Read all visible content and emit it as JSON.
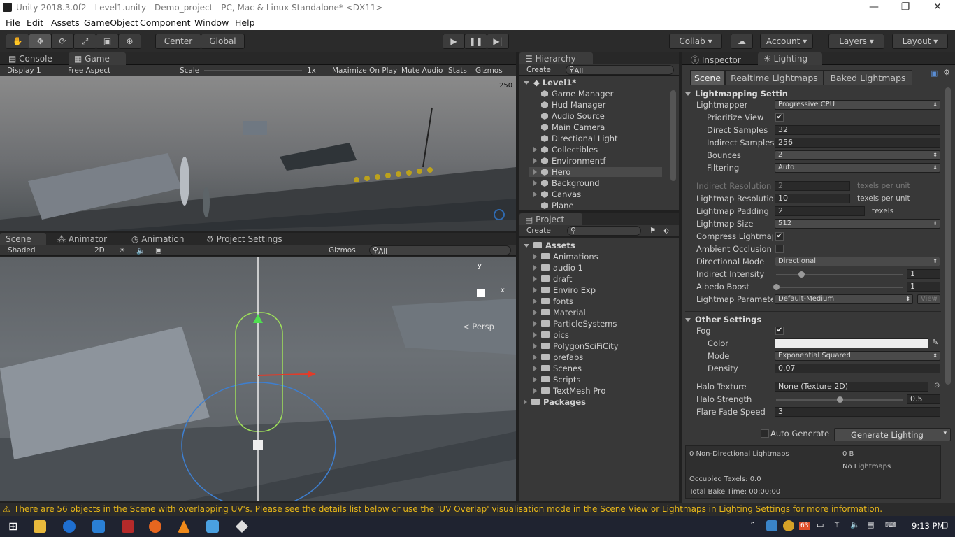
{
  "window": {
    "title": "Unity 2018.3.0f2 - Level1.unity - Demo_project - PC, Mac & Linux Standalone* <DX11>"
  },
  "menu": [
    "File",
    "Edit",
    "Assets",
    "GameObject",
    "Component",
    "Window",
    "Help"
  ],
  "toolbar": {
    "center": "Center",
    "global": "Global",
    "collab": "Collab",
    "account": "Account",
    "layers": "Layers",
    "layout": "Layout"
  },
  "game_panel": {
    "tabs": [
      "Console",
      "Game"
    ],
    "display": "Display 1",
    "aspect": "Free Aspect",
    "scale_label": "Scale",
    "scale_value": "1x",
    "maximize": "Maximize On Play",
    "mute": "Mute Audio",
    "stats": "Stats",
    "gizmos": "Gizmos",
    "fps_badge": "250"
  },
  "scene_panel": {
    "tabs": [
      "Scene",
      "Animator",
      "Animation",
      "Project Settings"
    ],
    "shading": "Shaded",
    "mode2d": "2D",
    "gizmos": "Gizmos",
    "search_placeholder": "All",
    "persp": "Persp",
    "gizmo_axes": {
      "y": "y",
      "x": "x"
    }
  },
  "hierarchy": {
    "title": "Hierarchy",
    "create": "Create",
    "search_placeholder": "All",
    "scene": "Level1*",
    "items": [
      {
        "label": "Game Manager",
        "expandable": false
      },
      {
        "label": "Hud Manager",
        "expandable": false
      },
      {
        "label": "Audio Source",
        "expandable": false
      },
      {
        "label": "Main Camera",
        "expandable": false
      },
      {
        "label": "Directional Light",
        "expandable": false
      },
      {
        "label": "Collectibles",
        "expandable": true
      },
      {
        "label": "Environmentf",
        "expandable": true
      },
      {
        "label": "Hero",
        "expandable": true
      },
      {
        "label": "Background",
        "expandable": true
      },
      {
        "label": "Canvas",
        "expandable": true
      },
      {
        "label": "Plane",
        "expandable": false
      }
    ]
  },
  "project": {
    "title": "Project",
    "create": "Create",
    "assets_root": "Assets",
    "folders": [
      "Animations",
      "audio 1",
      "draft",
      "Enviro Exp",
      "fonts",
      "Material",
      "ParticleSystems",
      "pics",
      "PolygonSciFiCity",
      "prefabs",
      "Scenes",
      "Scripts",
      "TextMesh Pro"
    ],
    "packages": "Packages"
  },
  "inspector": {
    "tabs": [
      "Inspector",
      "Lighting"
    ],
    "subtabs": [
      "Scene",
      "Realtime Lightmaps",
      "Baked Lightmaps"
    ],
    "lightmapping": {
      "header": "Lightmapping Settin",
      "lightmapper_label": "Lightmapper",
      "lightmapper": "Progressive CPU",
      "prioritize_label": "Prioritize View",
      "direct_label": "Direct Samples",
      "direct": "32",
      "indirect_label": "Indirect Samples",
      "indirect": "256",
      "bounces_label": "Bounces",
      "bounces": "2",
      "filtering_label": "Filtering",
      "filtering": "Auto",
      "indirect_res_label": "Indirect Resolution",
      "indirect_res": "2",
      "texels_per_unit": "texels per unit",
      "lightmap_res_label": "Lightmap Resolutior",
      "lightmap_res": "10",
      "padding_label": "Lightmap Padding",
      "padding": "2",
      "texels": "texels",
      "size_label": "Lightmap Size",
      "size": "512",
      "compress_label": "Compress Lightmap",
      "ao_label": "Ambient Occlusion",
      "dirmode_label": "Directional Mode",
      "dirmode": "Directional",
      "intensity_label": "Indirect Intensity",
      "intensity": "1",
      "intensity_fraction": 0.2,
      "albedo_label": "Albedo Boost",
      "albedo": "1",
      "albedo_fraction": 0.0,
      "params_label": "Lightmap Paramete",
      "params": "Default-Medium",
      "view": "View"
    },
    "other": {
      "header": "Other Settings",
      "fog_label": "Fog",
      "color_label": "Color",
      "mode_label": "Mode",
      "mode": "Exponential Squared",
      "density_label": "Density",
      "density": "0.07",
      "halo_tex_label": "Halo Texture",
      "halo_tex": "None (Texture 2D)",
      "halo_strength_label": "Halo Strength",
      "halo_strength": "0.5",
      "halo_fraction": 0.5,
      "flare_label": "Flare Fade Speed",
      "flare": "3"
    },
    "auto_generate": "Auto Generate",
    "generate": "Generate Lighting",
    "stats": {
      "non_dir": "0 Non-Directional Lightmaps",
      "bytes": "0 B",
      "no_lightmaps": "No Lightmaps",
      "occupied": "Occupied Texels: 0.0",
      "bake_time": "Total Bake Time: 00:00:00"
    }
  },
  "status": "There are 56 objects in the Scene with overlapping UV's. Please see the details list below or use the 'UV Overlap' visualisation mode in the Scene View or Lightmaps in Lighting Settings for more information.",
  "taskbar": {
    "time": "9:13 PM",
    "badge": "63"
  }
}
